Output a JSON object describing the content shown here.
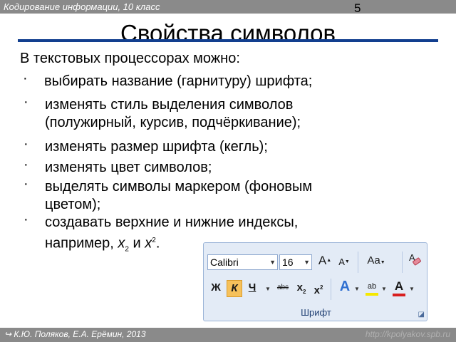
{
  "header": {
    "course": "Кодирование информации, 10 класс",
    "page_number": "5"
  },
  "slide": {
    "title": "Свойства символов",
    "intro": "В текстовых процессорах можно:",
    "bullet_marker": "·",
    "bullets": [
      "выбирать название (гарнитуру) шрифта;",
      "изменять стиль выделения символов",
      "(полужирный, курсив, подчёркивание);",
      "изменять размер шрифта (кегль);",
      "изменять цвет символов;",
      "выделять символы маркером (фоновым",
      "цветом);",
      "создавать верхние и нижние индексы,",
      "например, ",
      "x",
      "2",
      " и ",
      "x",
      "2",
      "."
    ]
  },
  "ribbon": {
    "font_name": "Calibri",
    "font_size": "16",
    "grow_font": "A",
    "shrink_font": "A",
    "change_case": "Aa",
    "bold": "Ж",
    "italic": "К",
    "underline": "Ч",
    "strikethrough": "abc",
    "subscript": "x",
    "subscript_mark": "2",
    "superscript": "x",
    "superscript_mark": "2",
    "text_effects": "A",
    "highlight": "ab",
    "font_color": "A",
    "group_label": "Шрифт",
    "colors": {
      "highlight": "#f5e800",
      "font_color": "#d81f1f",
      "italic_active": "#f6c15b"
    }
  },
  "footer": {
    "authors": "К.Ю. Поляков, Е.А. Ерёмин, 2013",
    "site": "http://kpolyakov.spb.ru"
  }
}
